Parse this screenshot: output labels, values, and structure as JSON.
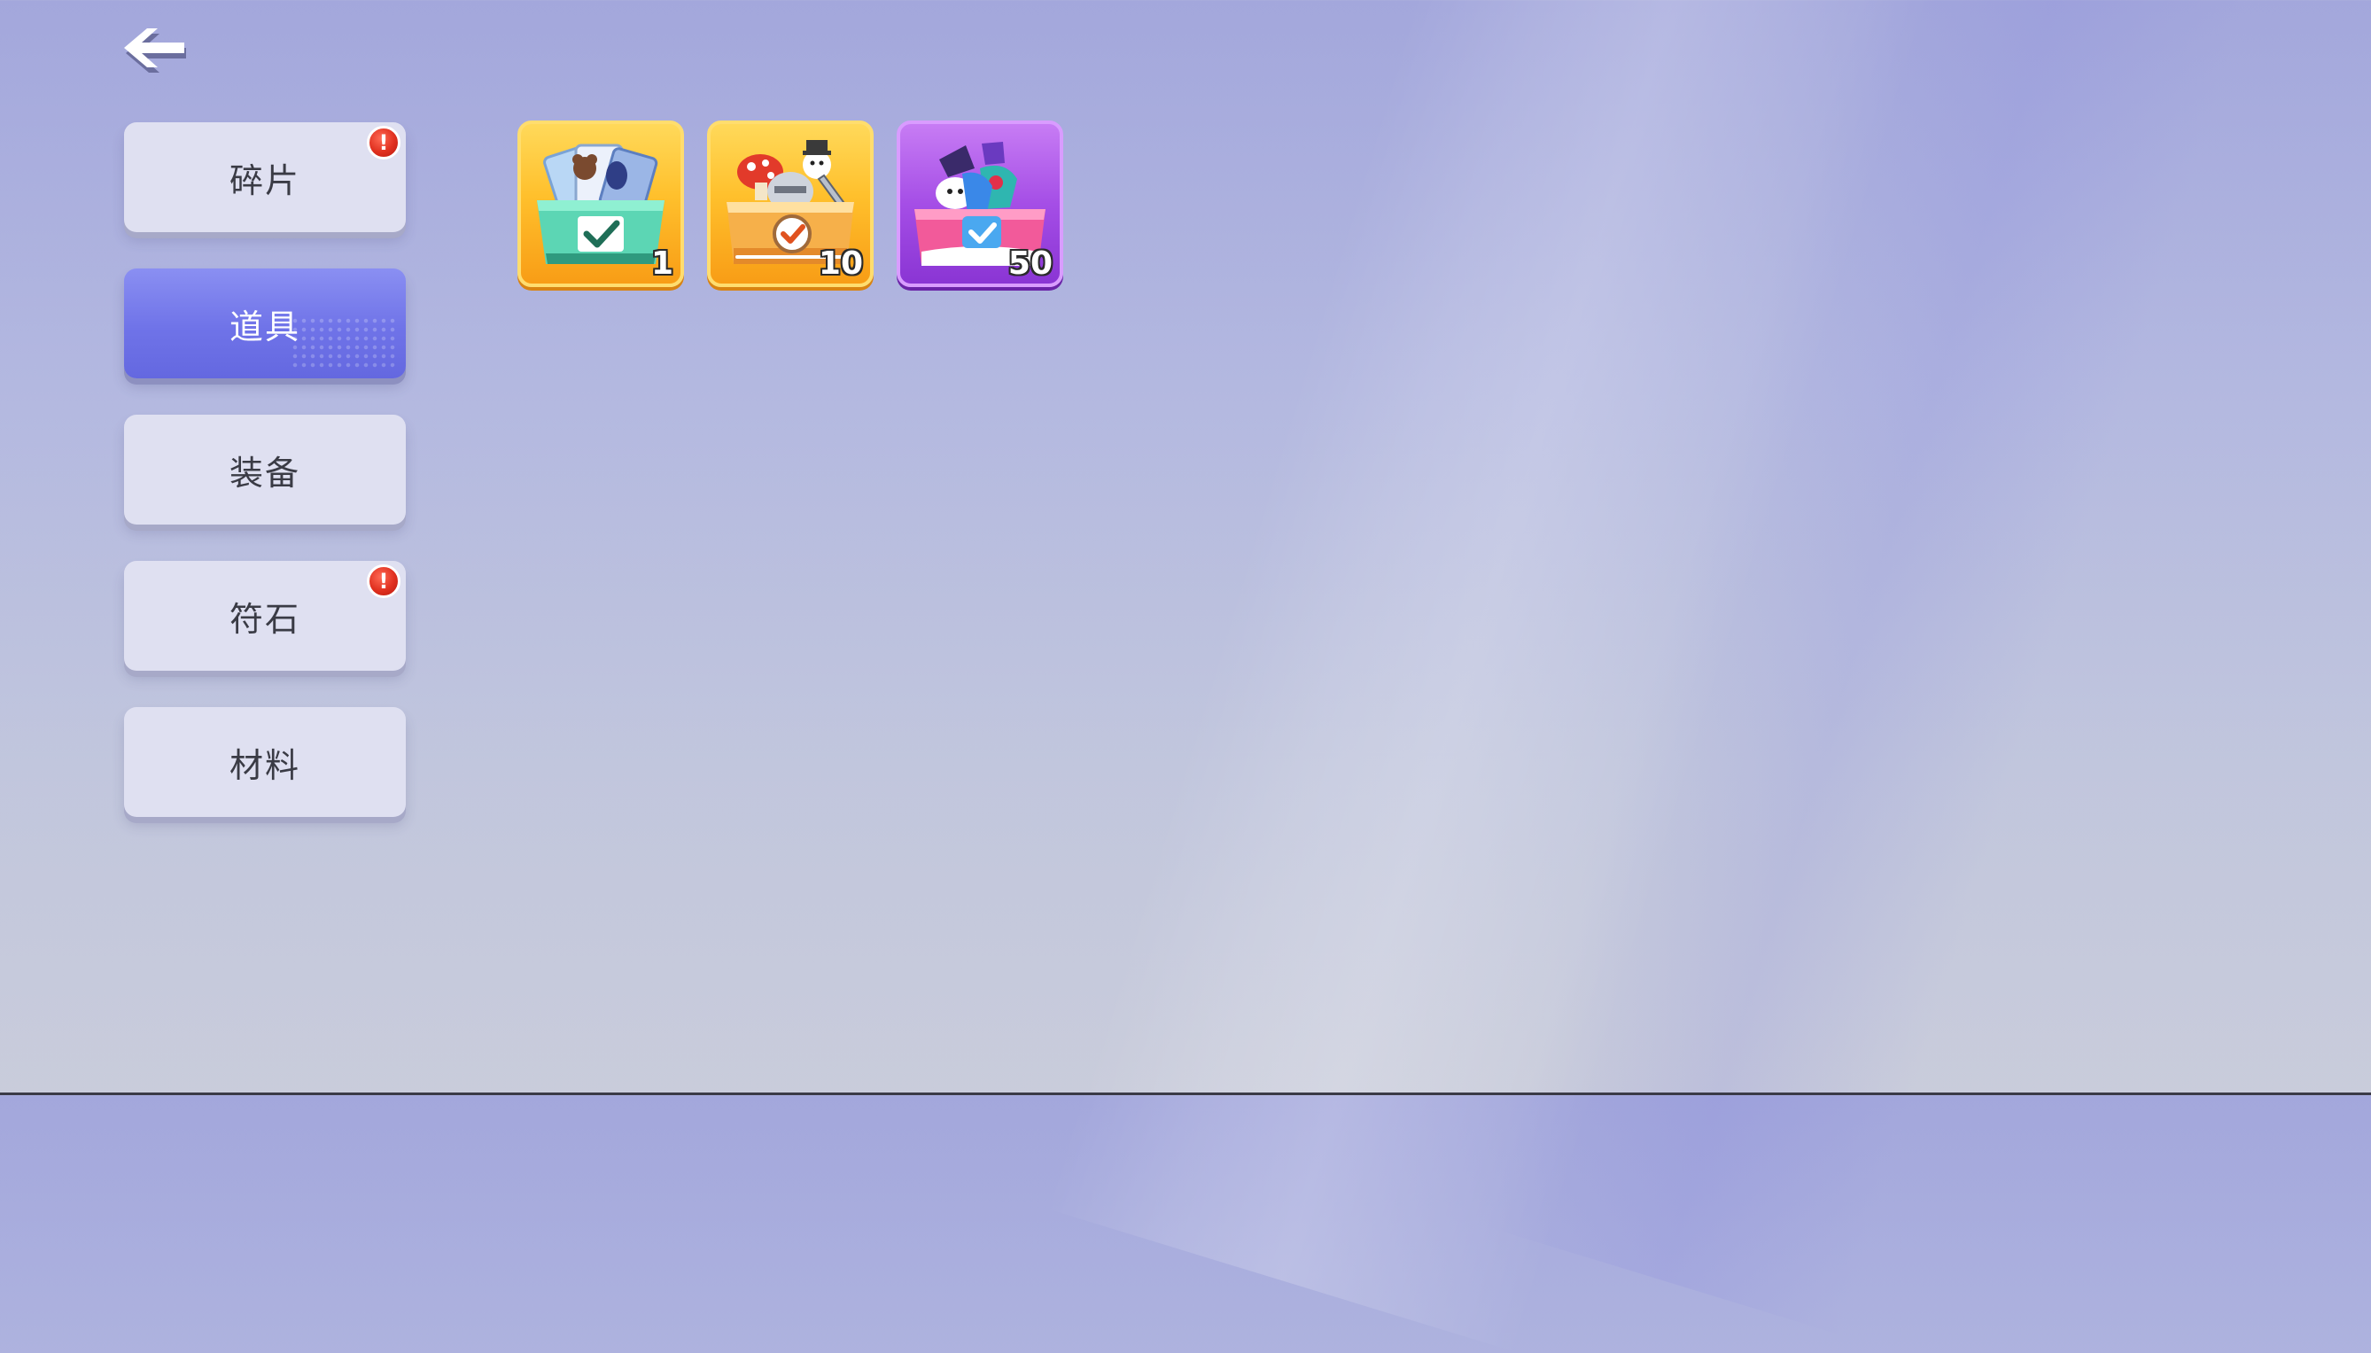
{
  "header": {
    "back_icon": "back-arrow-icon"
  },
  "sidebar": {
    "active_index": 1,
    "items": [
      {
        "label": "碎片",
        "has_alert": true,
        "alert_text": "!"
      },
      {
        "label": "道具",
        "has_alert": false,
        "active": true
      },
      {
        "label": "装备",
        "has_alert": false
      },
      {
        "label": "符石",
        "has_alert": true,
        "alert_text": "!"
      },
      {
        "label": "材料",
        "has_alert": false
      }
    ]
  },
  "items": [
    {
      "name": "fragment-selection-box",
      "icon": "card-box-icon",
      "rarity": "orange",
      "count": "1"
    },
    {
      "name": "equipment-selection-box",
      "icon": "equipment-box-icon",
      "rarity": "orange",
      "count": "10"
    },
    {
      "name": "costume-selection-box",
      "icon": "costume-box-icon",
      "rarity": "purple",
      "count": "50"
    }
  ],
  "colors": {
    "active_tab": "#6f73e8",
    "tab_bg": "#dfe0f1",
    "alert_badge": "#e0301f",
    "orange_frame": "#ffc02c",
    "purple_frame": "#a54ee6"
  }
}
